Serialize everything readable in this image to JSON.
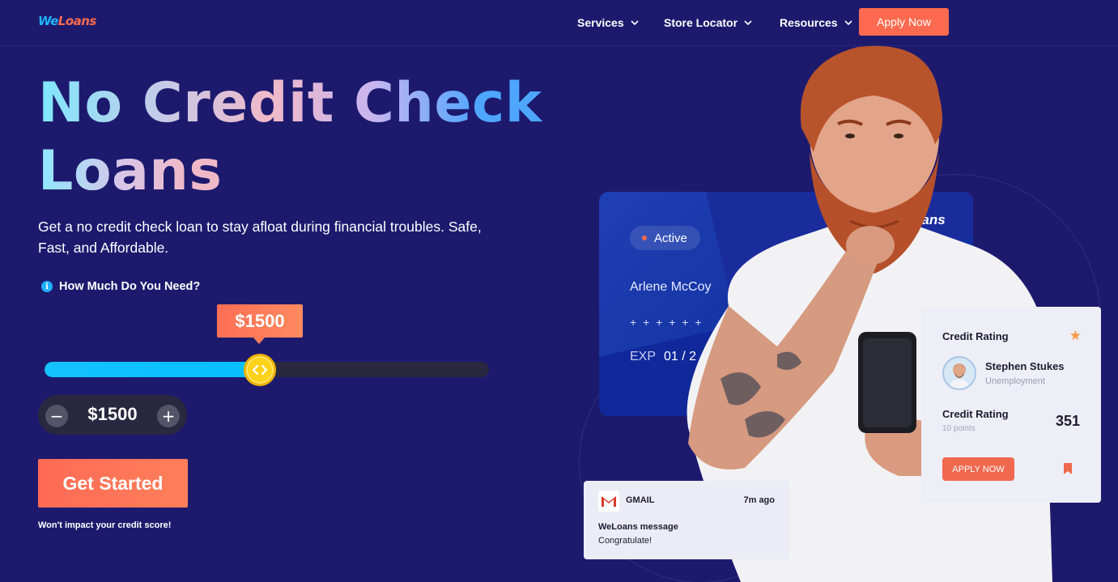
{
  "header": {
    "logo_we": "We",
    "logo_loans": "Loans",
    "nav": [
      {
        "label": "Services"
      },
      {
        "label": "Store Locator"
      },
      {
        "label": "Resources"
      }
    ],
    "apply_now": "Apply Now"
  },
  "hero": {
    "title_line1": "No Credit Check",
    "title_line2": "Loans",
    "subtitle": "Get a no credit check loan to stay afloat during financial troubles. Safe, Fast, and Affordable.",
    "question": "How Much Do You Need?",
    "info_icon": "i"
  },
  "slider": {
    "bubble_value": "$1500",
    "fill_fraction": 0.48,
    "thumb_icon": "‹›",
    "stepper_value": "$1500",
    "minus": "−",
    "plus": "+"
  },
  "cta": {
    "get_started": "Get Started",
    "disclaimer": "Won't impact your credit score!"
  },
  "card": {
    "status": "Active",
    "holder": "Arlene McCoy",
    "number": "+ + + +     + +",
    "exp_label": "EXP",
    "exp_value": "01 / 2",
    "brand": "oans"
  },
  "gmail": {
    "title": "GMAIL",
    "time": "7m ago",
    "message_title": "WeLoans message",
    "message_text": "Congratulate!"
  },
  "credit": {
    "title": "Credit Rating",
    "name": "Stephen Stukes",
    "role": "Unemployment",
    "rating_label": "Credit Rating",
    "points": "10 points",
    "score": "351",
    "apply": "APPLY NOW"
  },
  "colors": {
    "background": "#1d1a6e",
    "accent": "#fe6a4f",
    "slider_fill": "#16c2ff",
    "thumb": "#ffd21a"
  }
}
